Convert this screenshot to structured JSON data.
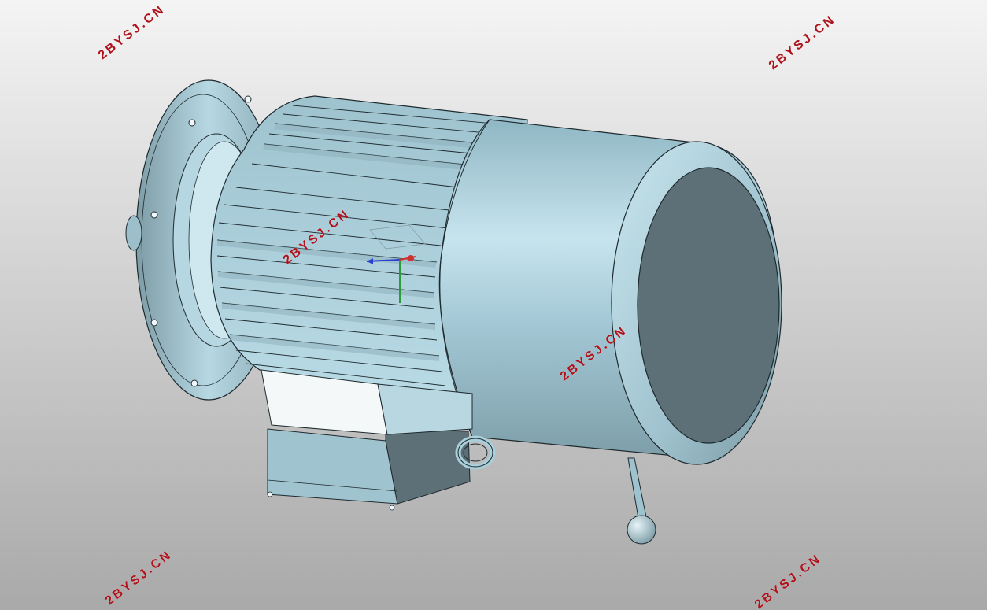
{
  "viewport": {
    "background_top": "#f4f4f4",
    "background_bottom": "#a9a9a9",
    "model_color": "#a9cfdb",
    "model_dark": "#5d7078",
    "edge_color": "#1e2a2e"
  },
  "model": {
    "name_icon": "electric-motor-3d-model"
  },
  "triad": {
    "x_color": "#d03030",
    "y_color": "#2a9a3a",
    "z_color": "#2a40d0"
  },
  "watermarks": [
    {
      "text": "2BYSJ.CN"
    },
    {
      "text": "2BYSJ.CN"
    },
    {
      "text": "2BYSJ.CN"
    },
    {
      "text": "2BYSJ.CN"
    },
    {
      "text": "2BYSJ.CN"
    },
    {
      "text": "2BYSJ.CN"
    }
  ]
}
